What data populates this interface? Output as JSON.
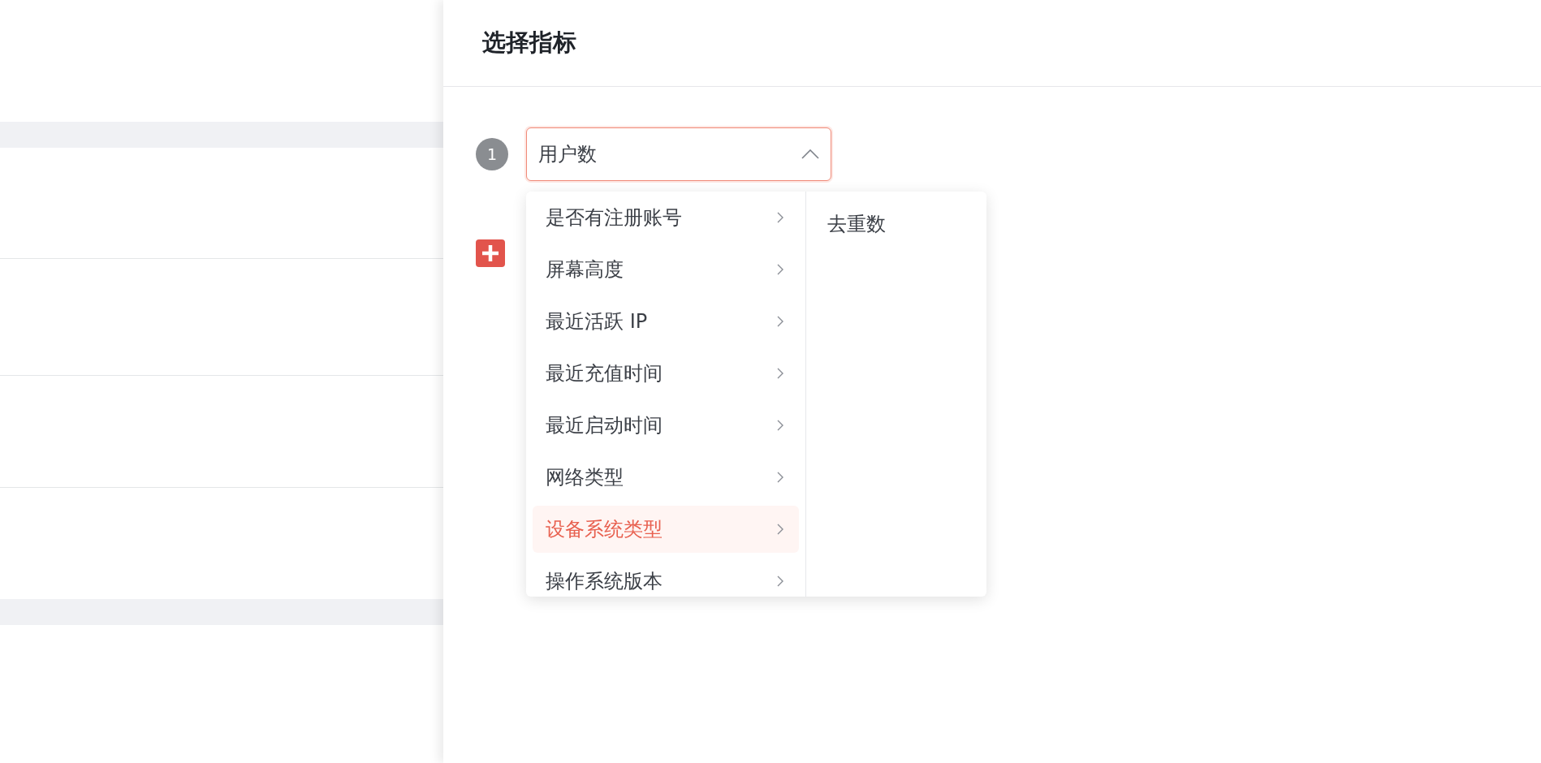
{
  "drawer": {
    "title": "选择指标"
  },
  "metrics": [
    {
      "index": "1",
      "value": "用户数",
      "expanded": true
    }
  ],
  "menu": {
    "properties": [
      {
        "label": "是否有注册账号",
        "selected": false
      },
      {
        "label": "屏幕高度",
        "selected": false
      },
      {
        "label": "最近活跃 IP",
        "selected": false
      },
      {
        "label": "最近充值时间",
        "selected": false
      },
      {
        "label": "最近启动时间",
        "selected": false
      },
      {
        "label": "网络类型",
        "selected": false
      },
      {
        "label": "设备系统类型",
        "selected": true
      },
      {
        "label": "操作系统版本",
        "selected": false
      }
    ],
    "aggregations": [
      {
        "label": "去重数",
        "selected": false
      }
    ]
  }
}
